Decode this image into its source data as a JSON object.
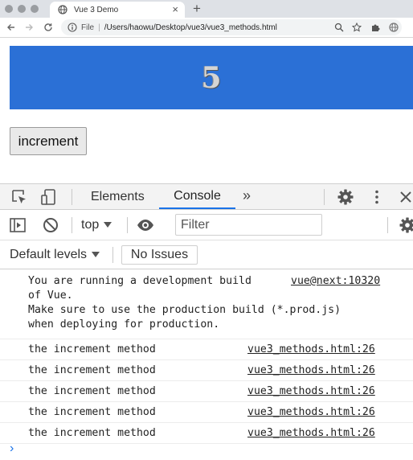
{
  "browser": {
    "tab_title": "Vue 3 Demo",
    "tab_close": "×",
    "new_tab": "+",
    "address": {
      "scheme": "File",
      "separator": "|",
      "url": "/Users/haowu/Desktop/vue3/vue3_methods.html"
    }
  },
  "page": {
    "count": "5",
    "increment_label": "increment"
  },
  "devtools": {
    "tabs": [
      "Elements",
      "Console"
    ],
    "more": "»",
    "context": "top",
    "filter_placeholder": "Filter",
    "default_levels": "Default levels",
    "no_issues": "No Issues",
    "console": {
      "dev_warning": {
        "line1": "You are running a development build ",
        "link": "vue@next:10320",
        "line2": "of Vue.",
        "line3": "Make sure to use the production build (*.prod.js)",
        "line4": "when deploying for production."
      },
      "logs": [
        {
          "text": "the increment method",
          "source": "vue3_methods.html:26"
        },
        {
          "text": "the increment method",
          "source": "vue3_methods.html:26"
        },
        {
          "text": "the increment method",
          "source": "vue3_methods.html:26"
        },
        {
          "text": "the increment method",
          "source": "vue3_methods.html:26"
        },
        {
          "text": "the increment method",
          "source": "vue3_methods.html:26"
        }
      ],
      "prompt": "›"
    }
  },
  "colors": {
    "counter_bg": "#2b70d6",
    "devtools_accent": "#1a73e8"
  }
}
